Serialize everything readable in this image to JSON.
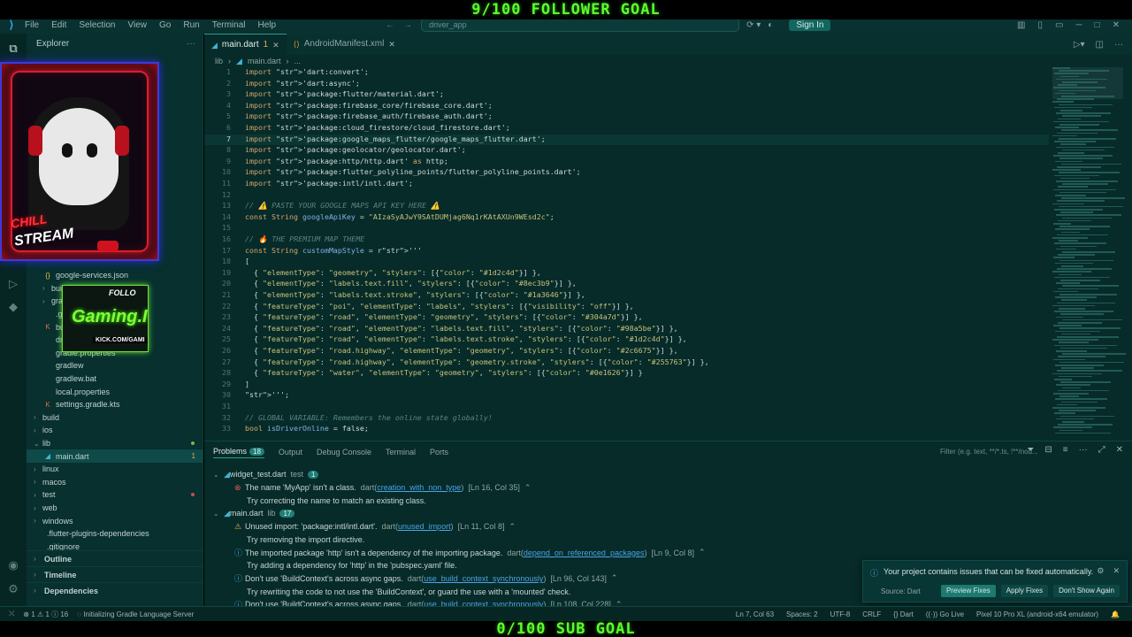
{
  "overlay": {
    "top_goal": "9/100 FOLLOWER GOAL",
    "bottom_goal": "0/100 SUB GOAL",
    "cam_text1": "CHILL",
    "cam_text2": "STREAM",
    "follow_text1": "FOLLO",
    "follow_text2": "Gaming.I",
    "follow_text3": "KICK.COM/GAMI"
  },
  "titlebar": {
    "menu": [
      "File",
      "Edit",
      "Selection",
      "View",
      "Go",
      "Run",
      "Terminal",
      "Help"
    ],
    "search": "driver_app",
    "signin": "Sign In"
  },
  "sidebar": {
    "title": "Explorer",
    "items": [
      {
        "label": "google-services.json",
        "depth": 1,
        "kind": "json"
      },
      {
        "label": "build",
        "depth": 1,
        "kind": "folder"
      },
      {
        "label": "gra",
        "depth": 1,
        "kind": "folder"
      },
      {
        "label": ".gi",
        "depth": 1,
        "kind": "file"
      },
      {
        "label": "buil",
        "depth": 1,
        "kind": "kotlin"
      },
      {
        "label": "drive",
        "depth": 1,
        "kind": "file"
      },
      {
        "label": "gradle.properties",
        "depth": 1,
        "kind": "file"
      },
      {
        "label": "gradlew",
        "depth": 1,
        "kind": "file"
      },
      {
        "label": "gradlew.bat",
        "depth": 1,
        "kind": "file"
      },
      {
        "label": "local.properties",
        "depth": 1,
        "kind": "file"
      },
      {
        "label": "settings.gradle.kts",
        "depth": 1,
        "kind": "kotlin"
      },
      {
        "label": "build",
        "depth": 0,
        "kind": "folder"
      },
      {
        "label": "ios",
        "depth": 0,
        "kind": "folder"
      },
      {
        "label": "lib",
        "depth": 0,
        "kind": "folder-open",
        "dot": "#7db24a"
      },
      {
        "label": "main.dart",
        "depth": 1,
        "kind": "dart",
        "badge": "1",
        "active": true
      },
      {
        "label": "linux",
        "depth": 0,
        "kind": "folder"
      },
      {
        "label": "macos",
        "depth": 0,
        "kind": "folder"
      },
      {
        "label": "test",
        "depth": 0,
        "kind": "folder",
        "dot": "#c05050"
      },
      {
        "label": "web",
        "depth": 0,
        "kind": "folder"
      },
      {
        "label": "windows",
        "depth": 0,
        "kind": "folder"
      },
      {
        "label": ".flutter-plugins-dependencies",
        "depth": 0,
        "kind": "file"
      },
      {
        "label": ".gitignore",
        "depth": 0,
        "kind": "file"
      }
    ],
    "outline": "Outline",
    "timeline": "Timeline",
    "dependencies": "Dependencies"
  },
  "editor": {
    "tabs": [
      {
        "label": "main.dart",
        "modified": "1",
        "kind": "dart"
      },
      {
        "label": "AndroidManifest.xml",
        "kind": "xml"
      }
    ],
    "breadcrumb": [
      "lib",
      "main.dart",
      "..."
    ],
    "current_line": 7,
    "lines": [
      {
        "n": "1",
        "t": "import 'dart:convert';"
      },
      {
        "n": "2",
        "t": "import 'dart:async';"
      },
      {
        "n": "3",
        "t": "import 'package:flutter/material.dart';"
      },
      {
        "n": "4",
        "t": "import 'package:firebase_core/firebase_core.dart';"
      },
      {
        "n": "5",
        "t": "import 'package:firebase_auth/firebase_auth.dart';"
      },
      {
        "n": "6",
        "t": "import 'package:cloud_firestore/cloud_firestore.dart';"
      },
      {
        "n": "7",
        "t": "import 'package:google_maps_flutter/google_maps_flutter.dart';"
      },
      {
        "n": "8",
        "t": "import 'package:geolocator/geolocator.dart';"
      },
      {
        "n": "9",
        "t": "import 'package:http/http.dart' as http;"
      },
      {
        "n": "10",
        "t": "import 'package:flutter_polyline_points/flutter_polyline_points.dart';"
      },
      {
        "n": "11",
        "t": "import 'package:intl/intl.dart';"
      },
      {
        "n": "12",
        "t": ""
      },
      {
        "n": "13",
        "t": "// ⚠️ PASTE YOUR GOOGLE MAPS API KEY HERE ⚠️"
      },
      {
        "n": "14",
        "t": "const String googleApiKey = \"AIzaSyAJwY9SAtDUMjag6Nq1rKAtAXUn9WEsd2c\";"
      },
      {
        "n": "15",
        "t": ""
      },
      {
        "n": "16",
        "t": "// 🔥 THE PREMIUM MAP THEME"
      },
      {
        "n": "17",
        "t": "const String customMapStyle = r'''"
      },
      {
        "n": "18",
        "t": "["
      },
      {
        "n": "19",
        "t": "  { \"elementType\": \"geometry\", \"stylers\": [{\"color\": \"#1d2c4d\"}] },"
      },
      {
        "n": "20",
        "t": "  { \"elementType\": \"labels.text.fill\", \"stylers\": [{\"color\": \"#8ec3b9\"}] },"
      },
      {
        "n": "21",
        "t": "  { \"elementType\": \"labels.text.stroke\", \"stylers\": [{\"color\": \"#1a3646\"}] },"
      },
      {
        "n": "22",
        "t": "  { \"featureType\": \"poi\", \"elementType\": \"labels\", \"stylers\": [{\"visibility\": \"off\"}] },"
      },
      {
        "n": "23",
        "t": "  { \"featureType\": \"road\", \"elementType\": \"geometry\", \"stylers\": [{\"color\": \"#304a7d\"}] },"
      },
      {
        "n": "24",
        "t": "  { \"featureType\": \"road\", \"elementType\": \"labels.text.fill\", \"stylers\": [{\"color\": \"#98a5be\"}] },"
      },
      {
        "n": "25",
        "t": "  { \"featureType\": \"road\", \"elementType\": \"labels.text.stroke\", \"stylers\": [{\"color\": \"#1d2c4d\"}] },"
      },
      {
        "n": "26",
        "t": "  { \"featureType\": \"road.highway\", \"elementType\": \"geometry\", \"stylers\": [{\"color\": \"#2c6675\"}] },"
      },
      {
        "n": "27",
        "t": "  { \"featureType\": \"road.highway\", \"elementType\": \"geometry.stroke\", \"stylers\": [{\"color\": \"#255763\"}] },"
      },
      {
        "n": "28",
        "t": "  { \"featureType\": \"water\", \"elementType\": \"geometry\", \"stylers\": [{\"color\": \"#0e1626\"}] }"
      },
      {
        "n": "29",
        "t": "]"
      },
      {
        "n": "30",
        "t": "''';"
      },
      {
        "n": "31",
        "t": ""
      },
      {
        "n": "32",
        "t": "// GLOBAL VARIABLE: Remembers the online state globally!"
      },
      {
        "n": "33",
        "t": "bool isDriverOnline = false;"
      }
    ]
  },
  "panel": {
    "tabs": [
      {
        "label": "Problems",
        "count": "18",
        "active": true
      },
      {
        "label": "Output"
      },
      {
        "label": "Debug Console"
      },
      {
        "label": "Terminal"
      },
      {
        "label": "Ports"
      }
    ],
    "filter_placeholder": "Filter (e.g. text, **/*.ts, !**/nod...",
    "rows": [
      {
        "type": "group",
        "file": "widget_test.dart",
        "folder": "test",
        "count": "1"
      },
      {
        "type": "error",
        "msg": "The name 'MyApp' isn't a class.",
        "src": "dart",
        "code": "creation_with_non_type",
        "loc": "[Ln 16, Col 35]"
      },
      {
        "type": "hint",
        "msg": "Try correcting the name to match an existing class."
      },
      {
        "type": "group",
        "file": "main.dart",
        "folder": "lib",
        "count": "17"
      },
      {
        "type": "warn",
        "msg": "Unused import: 'package:intl/intl.dart'.",
        "src": "dart",
        "code": "unused_import",
        "loc": "[Ln 11, Col 8]"
      },
      {
        "type": "hint",
        "msg": "Try removing the import directive."
      },
      {
        "type": "info",
        "msg": "The imported package 'http' isn't a dependency of the importing package.",
        "src": "dart",
        "code": "depend_on_referenced_packages",
        "loc": "[Ln 9, Col 8]"
      },
      {
        "type": "hint",
        "msg": "Try adding a dependency for 'http' in the 'pubspec.yaml' file."
      },
      {
        "type": "info",
        "msg": "Don't use 'BuildContext's across async gaps.",
        "src": "dart",
        "code": "use_build_context_synchronously",
        "loc": "[Ln 96, Col 143]"
      },
      {
        "type": "hint",
        "msg": "Try rewriting the code to not use the 'BuildContext', or guard the use with a 'mounted' check."
      },
      {
        "type": "info",
        "msg": "Don't use 'BuildContext's across async gaps.",
        "src": "dart",
        "code": "use_build_context_synchronously",
        "loc": "[Ln 108, Col 228]"
      }
    ]
  },
  "toast": {
    "message": "Your project contains issues that can be fixed automatically.",
    "source": "Source: Dart",
    "btn_preview": "Preview Fixes",
    "btn_apply": "Apply Fixes",
    "btn_dismiss": "Don't Show Again"
  },
  "statusbar": {
    "errors": "1",
    "warnings": "1",
    "infos": "16",
    "task": "Initializing Gradle Language Server",
    "position": "Ln 7, Col 63",
    "spaces": "Spaces: 2",
    "encoding": "UTF-8",
    "eol": "CRLF",
    "language": "Dart",
    "golive": "Go Live",
    "device": "Pixel 10 Pro XL (android-x64 emulator)"
  }
}
